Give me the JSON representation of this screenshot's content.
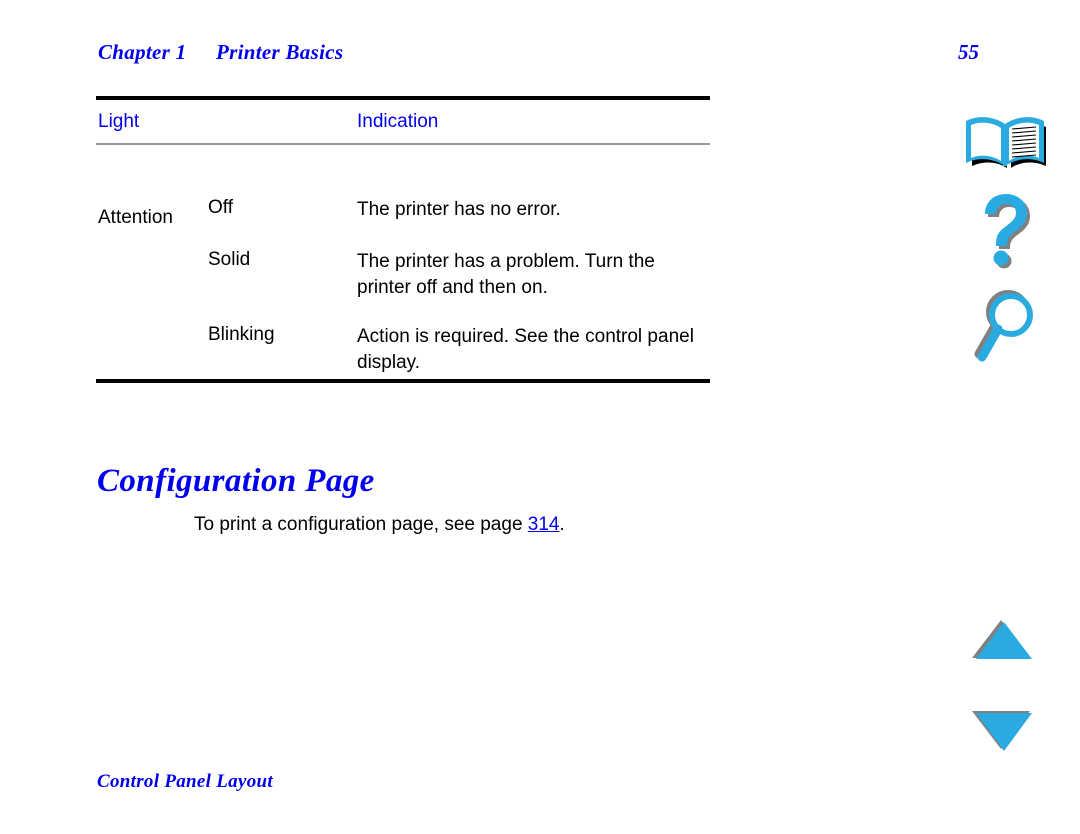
{
  "header": {
    "chapter_label": "Chapter 1",
    "chapter_title": "Printer Basics",
    "page_number": "55"
  },
  "status_table": {
    "columns": [
      "Light",
      "Indication"
    ],
    "group_label": "Attention",
    "rows": [
      {
        "state": "Off",
        "indication": "The printer has no error."
      },
      {
        "state": "Solid",
        "indication": "The printer has a problem. Turn the printer off and then on."
      },
      {
        "state": "Blinking",
        "indication": "Action is required. See the control panel display."
      }
    ]
  },
  "section": {
    "heading": "Configuration Page",
    "paragraph_before": "To print a configuration page, see page ",
    "paragraph_link": "314",
    "paragraph_after": "."
  },
  "footer": {
    "label": "Control Panel Layout"
  },
  "nav_rail": {
    "items": [
      {
        "icon": "open-book-icon",
        "label": "Contents"
      },
      {
        "icon": "question-mark-icon",
        "label": "Help"
      },
      {
        "icon": "magnifying-glass-icon",
        "label": "Search"
      },
      {
        "icon": "triangle-up-icon",
        "label": "Previous page"
      },
      {
        "icon": "triangle-down-icon",
        "label": "Next page"
      }
    ]
  },
  "colors": {
    "link_blue": "#0000EE",
    "icon_cyan": "#29ABE2",
    "icon_shadow": "#808080",
    "rule_black": "#000000",
    "rule_gray": "#999999"
  }
}
